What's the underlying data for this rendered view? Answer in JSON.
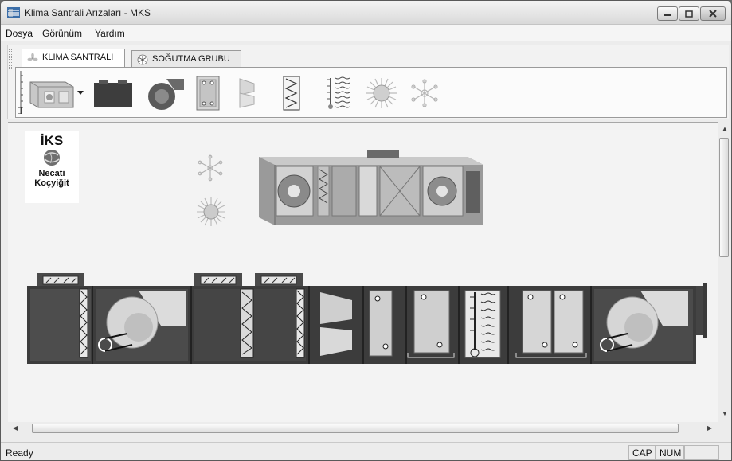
{
  "window": {
    "title": "Klima Santrali Arızaları - MKS"
  },
  "menu": {
    "items": [
      "Dosya",
      "Görünüm",
      "Yardım"
    ]
  },
  "tabs": [
    {
      "label": "KLIMA SANTRALI",
      "active": true
    },
    {
      "label": "SOĞUTMA GRUBU",
      "active": false
    }
  ],
  "toolbar": {
    "items": [
      "air-handling-unit-icon",
      "dropdown-arrow-icon",
      "mixing-box-icon",
      "centrifugal-fan-icon",
      "damper-panel-icon",
      "sound-attenuator-icon",
      "bag-filter-icon",
      "humidifier-icon",
      "heating-sun-icon",
      "cooling-snowflake-icon"
    ]
  },
  "logo": {
    "brand": "İKS",
    "name_line1": "Necati",
    "name_line2": "Koçyiğit"
  },
  "status": {
    "text": "Ready",
    "cap": "CAP",
    "num": "NUM"
  },
  "colors": {
    "unit_body": "#3a3a3a",
    "panel": "#b8b8b8",
    "canvas": "#f3f3f3"
  }
}
